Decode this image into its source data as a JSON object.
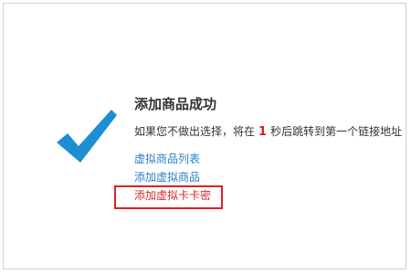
{
  "message": {
    "title": "添加商品成功",
    "redirect_prefix": "如果您不做出选择，将在",
    "redirect_seconds": "1",
    "redirect_suffix": "秒后跳转到第一个链接地址"
  },
  "links": [
    {
      "label": "虚拟商品列表"
    },
    {
      "label": "添加虚拟商品"
    },
    {
      "label": "添加虚拟卡卡密"
    }
  ],
  "colors": {
    "check": "#1c8fd3",
    "link": "#2b7fc4",
    "highlight": "#e02020",
    "countdown": "#e01b1b"
  },
  "icons": {
    "status": "checkmark-icon"
  }
}
